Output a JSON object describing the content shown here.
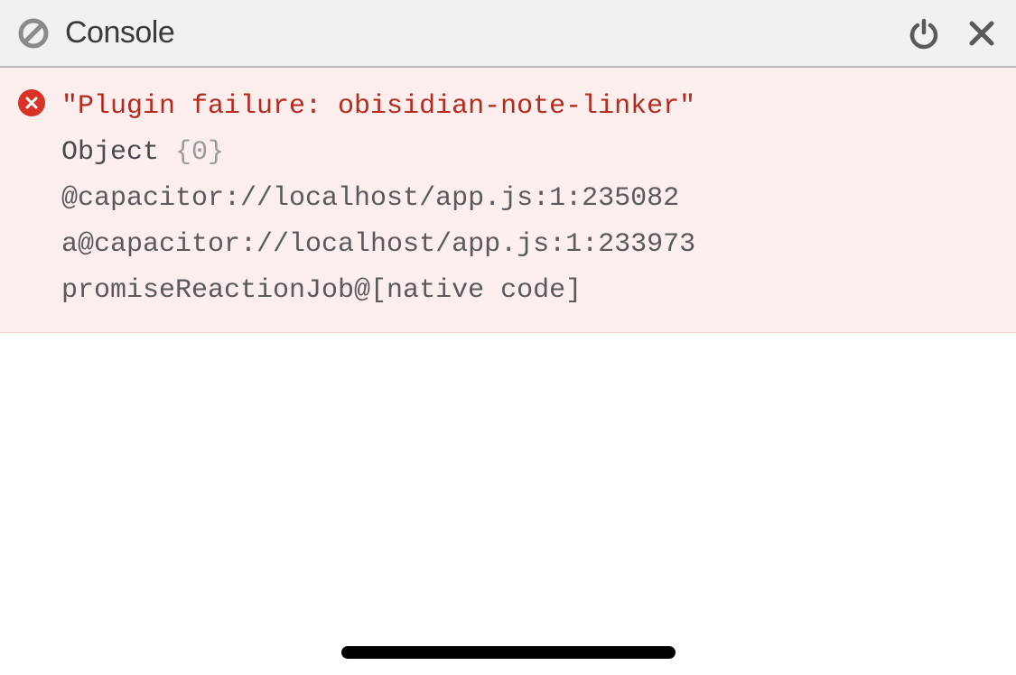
{
  "toolbar": {
    "title": "Console"
  },
  "error": {
    "message": "\"Plugin failure: obisidian-note-linker\"",
    "object_label": "Object",
    "object_count": "{0}",
    "stack": [
      "@capacitor://localhost/app.js:1:235082",
      "a@capacitor://localhost/app.js:1:233973",
      "promiseReactionJob@[native code]"
    ]
  }
}
